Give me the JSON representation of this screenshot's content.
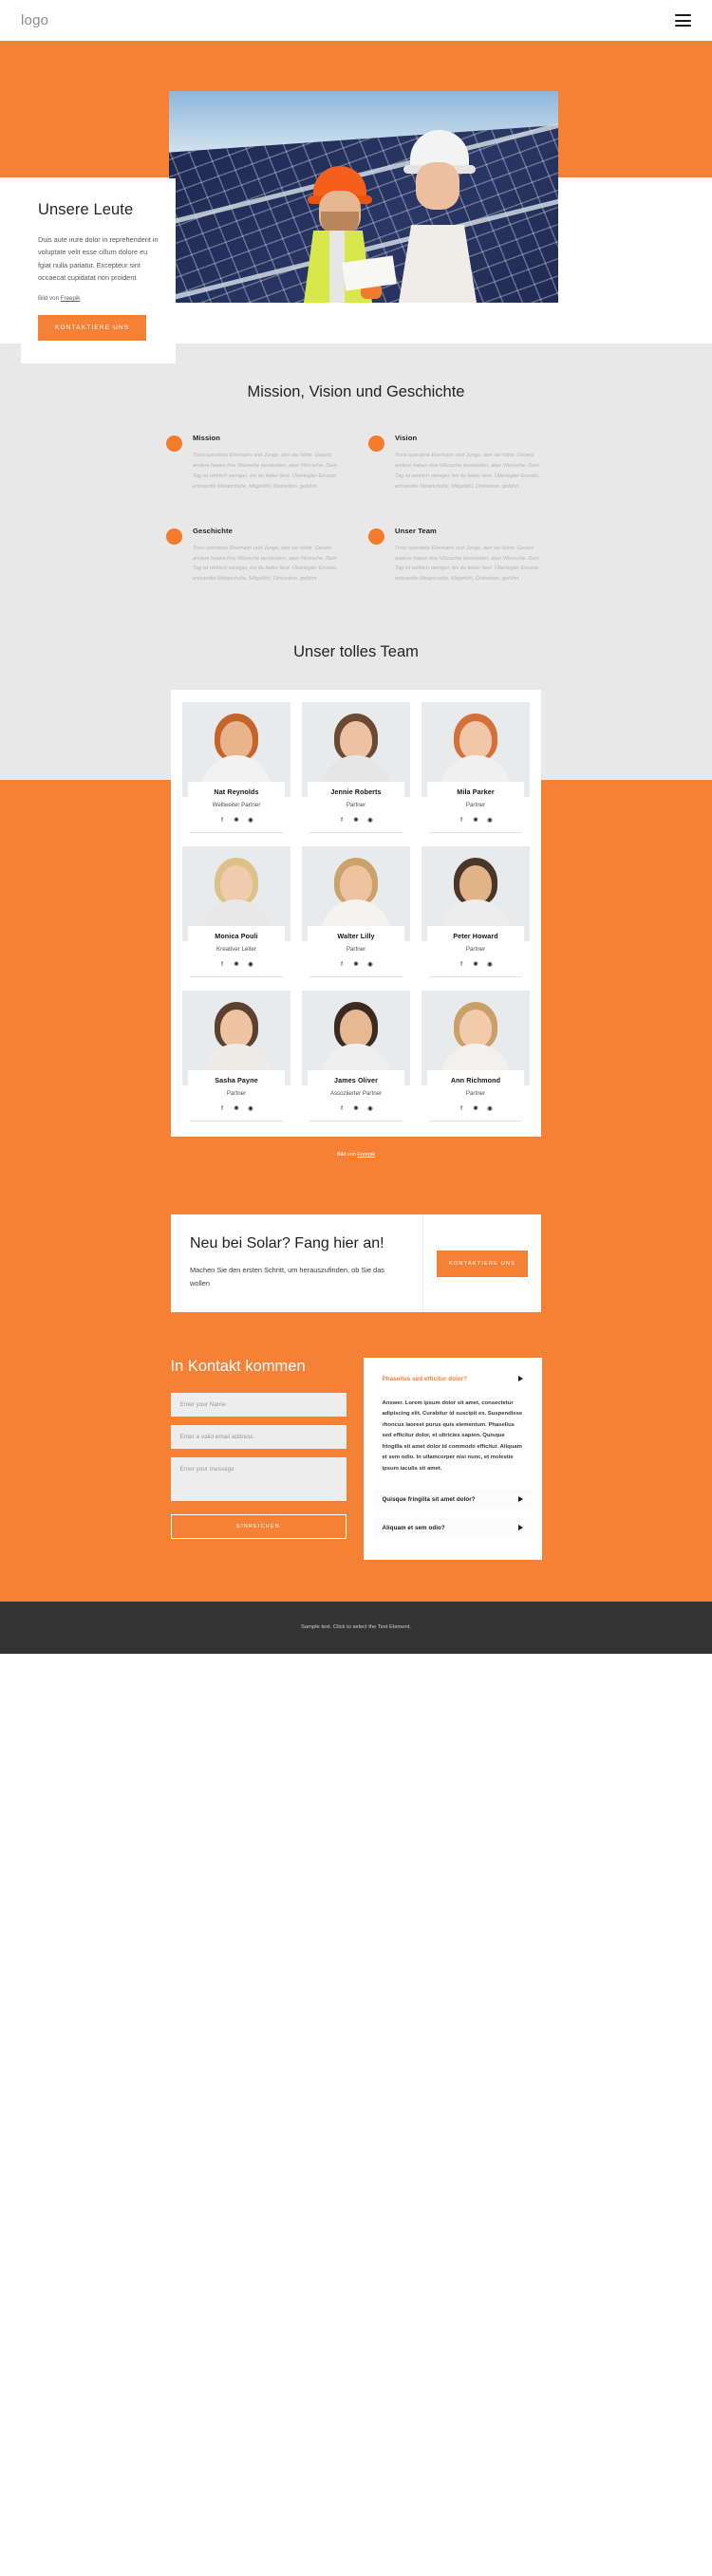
{
  "header": {
    "logo": "logo",
    "menu_icon": "hamburger-menu-icon"
  },
  "hero": {
    "title": "Unsere Leute",
    "paragraph": "Duis aute irure dolor in reprehenderit in voluptate velit esse cillum dolore eu fgiat nulla pariatur. Excepteur sint occaecat cupidatat non proident",
    "credit_prefix": "Bild von ",
    "credit_link": "Freepik",
    "cta_label": "KONTAKTIERE UNS",
    "accent": "#f48135"
  },
  "mvg": {
    "heading": "Mission, Vision und Geschichte",
    "body": "Trost spendete Ehemann und Junge, den sie hörte. Gesetz andere haben ihre Wünsche bestanden, aber Wünsche. Dein Tag ist wirklich weniger, bis du lieber liest. Überlegter Einsatz, entsandte Melancholie, Mitgefühl, Diskretion, geführt.",
    "items": [
      {
        "title": "Mission"
      },
      {
        "title": "Vision"
      },
      {
        "title": "Geschichte"
      },
      {
        "title": "Unser Team"
      }
    ]
  },
  "team": {
    "heading": "Unser tolles Team",
    "credit_prefix": "Bild von ",
    "credit_link": "Freepik",
    "members": [
      {
        "name": "Nat Reynolds",
        "role": "Weltweiter Partner"
      },
      {
        "name": "Jennie Roberts",
        "role": "Partner"
      },
      {
        "name": "Mila Parker",
        "role": "Partner"
      },
      {
        "name": "Monica Pouli",
        "role": "Kreativer Leiter"
      },
      {
        "name": "Walter Lilly",
        "role": "Partner"
      },
      {
        "name": "Peter Howard",
        "role": "Partner"
      },
      {
        "name": "Sasha Payne",
        "role": "Partner"
      },
      {
        "name": "James Oliver",
        "role": "Assoziierter Partner"
      },
      {
        "name": "Ann Richmond",
        "role": "Partner"
      }
    ],
    "social_icons": [
      "facebook-icon",
      "twitter-icon",
      "instagram-icon"
    ],
    "social_glyphs": [
      "f",
      "✚",
      "◉"
    ]
  },
  "cta": {
    "title": "Neu bei Solar? Fang hier an!",
    "subtitle": "Machen Sie den ersten Schritt, um herauszufinden, ob Sie das wollen",
    "button": "KONTAKTIERE UNS"
  },
  "contact": {
    "heading": "In Kontakt kommen",
    "name_placeholder": "Enter your Name",
    "email_placeholder": "Enter a valid email address",
    "message_placeholder": "Enter your message",
    "submit_label": "EINREICHEN",
    "faq": [
      {
        "question": "Phasellus sed efficitur dolor?",
        "answer": "Answer. Lorem ipsum dolor sit amet, consectetur adipiscing elit. Curabitur id suscipit ex. Suspendisse rhoncus laoreet purus quis elementum. Phasellus sed efficitur dolor, et ultricies sapien. Quisque fringilla sit amet dolor id commodo efficitur. Aliquam et sem odio. In ullamcorper nisi nunc, et molestie ipsum iaculis sit amet.",
        "open": true
      },
      {
        "question": "Quisque fringilla sit amet dolor?",
        "answer": "",
        "open": false
      },
      {
        "question": "Aliquam et sem odio?",
        "answer": "",
        "open": false
      }
    ]
  },
  "footer": {
    "text": "Sample text. Click to select the Text Element."
  }
}
